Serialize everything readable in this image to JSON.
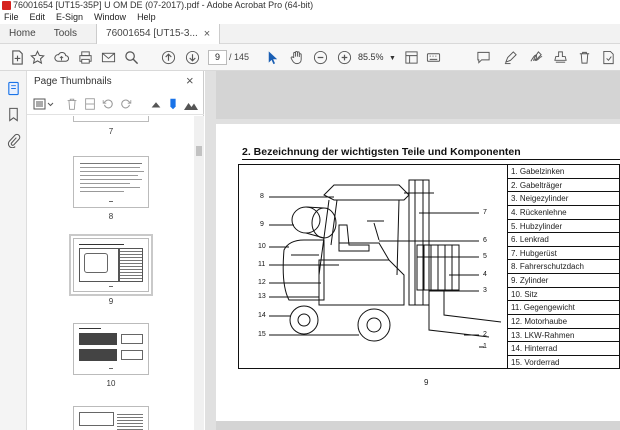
{
  "window": {
    "title": "76001654 [UT15-35P] U OM DE (07-2017).pdf - Adobe Acrobat Pro (64-bit)"
  },
  "menu": [
    "File",
    "Edit",
    "E-Sign",
    "Window",
    "Help"
  ],
  "tabs": {
    "home": "Home",
    "tools": "Tools",
    "document": "76001654 [UT15-3...",
    "close": "×"
  },
  "toolbar": {
    "current_page": "9",
    "total_pages": "/ 145",
    "zoom": "85.5%"
  },
  "panel": {
    "title": "Page Thumbnails",
    "close": "×"
  },
  "thumbnails": [
    {
      "label": "7"
    },
    {
      "label": "8"
    },
    {
      "label": "9"
    },
    {
      "label": "10"
    }
  ],
  "page": {
    "heading": "2. Bezeichnung der wichtigsten Teile und Komponenten",
    "page_number": "9",
    "callouts_left": [
      "8",
      "9",
      "10",
      "11",
      "12",
      "13",
      "14",
      "15"
    ],
    "callouts_right": [
      "7",
      "6",
      "5",
      "4",
      "3",
      "2",
      "1"
    ],
    "legend": [
      "1. Gabelzinken",
      "2. Gabelträger",
      "3. Neigezylinder",
      "4. Rückenlehne",
      "5. Hubzylinder",
      "6. Lenkrad",
      "7. Hubgerüst",
      "8. Fahrerschutzdach",
      "9. Zylinder",
      "10. Sitz",
      "11. Gegengewicht",
      "12. Motorhaube",
      "13. LKW-Rahmen",
      "14. Hinterrad",
      "15. Vorderrad"
    ]
  },
  "colors": {
    "accent": "#1a73e8",
    "app_icon": "#d6231e"
  }
}
